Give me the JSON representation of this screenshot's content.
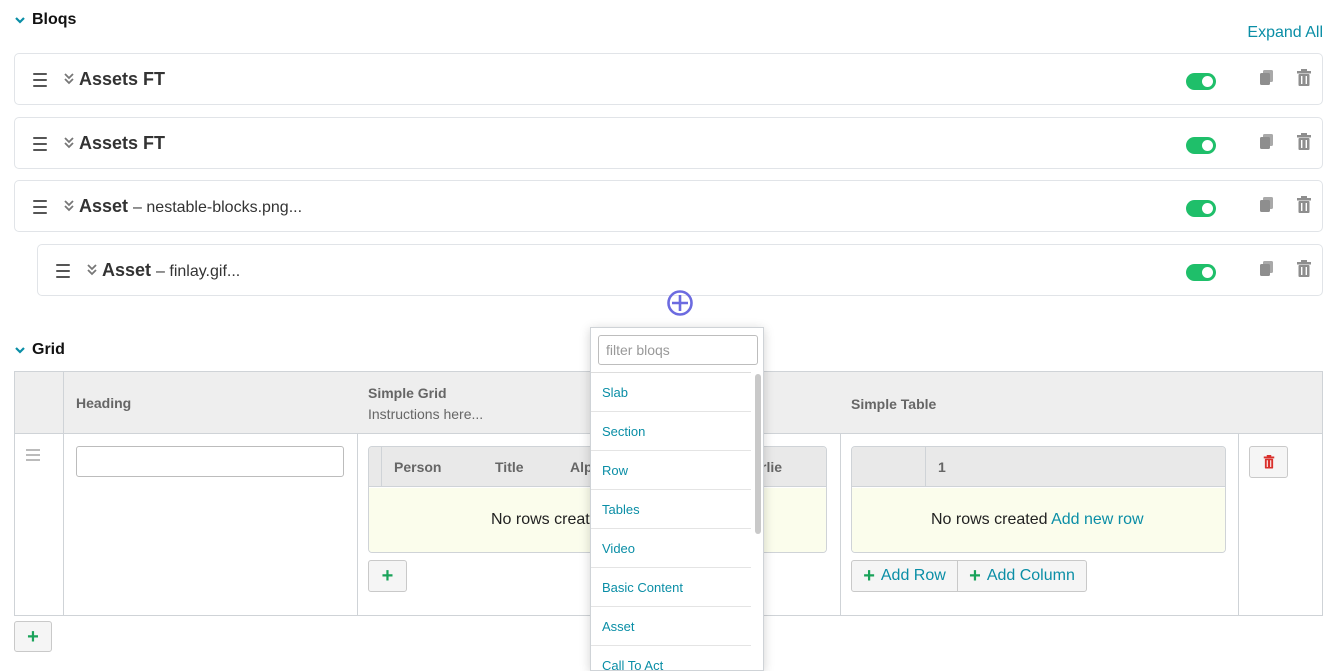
{
  "sections": {
    "bloqs": {
      "title": "Bloqs",
      "expand_all": "Expand All"
    },
    "grid": {
      "title": "Grid"
    }
  },
  "bloqs": [
    {
      "title": "Assets FT",
      "subtitle": "",
      "enabled": true
    },
    {
      "title": "Assets FT",
      "subtitle": "",
      "enabled": true
    },
    {
      "title": "Asset",
      "subtitle": "– nestable-blocks.png...",
      "enabled": true
    },
    {
      "title": "Asset",
      "subtitle": "– finlay.gif...",
      "enabled": true
    }
  ],
  "grid": {
    "columns": {
      "heading": "Heading",
      "simple_grid": "Simple Grid",
      "simple_grid_instructions": "Instructions here...",
      "simple_table": "Simple Table"
    },
    "heading_value": "",
    "simple_grid_table": {
      "columns": [
        "Person",
        "Title",
        "Alp",
        "rlie"
      ],
      "empty_text": "No rows creat"
    },
    "simple_table": {
      "columns": [
        "1"
      ],
      "empty_text": "No rows created",
      "add_link": "Add new row",
      "add_row": "Add Row",
      "add_column": "Add Column"
    }
  },
  "dropdown": {
    "placeholder": "filter bloqs",
    "items": [
      "Slab",
      "Section",
      "Row",
      "Tables",
      "Video",
      "Basic Content",
      "Asset",
      "Call To Act"
    ]
  },
  "colors": {
    "accent": "#0a8ea6",
    "toggle_on": "#1fbf6a",
    "add_icon": "#6c6be0",
    "delete": "#d9302c"
  }
}
